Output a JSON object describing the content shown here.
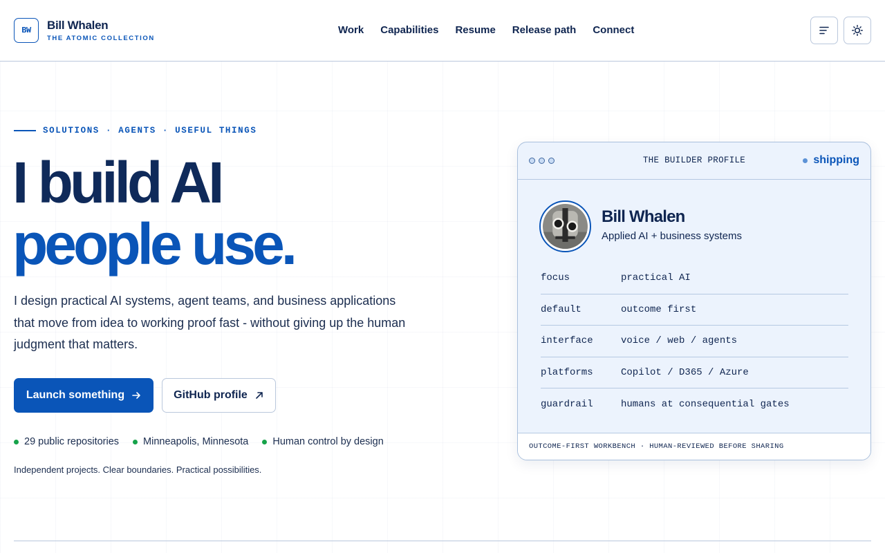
{
  "brand": {
    "initials": "BW",
    "name": "Bill Whalen",
    "tagline": "THE ATOMIC COLLECTION"
  },
  "nav": {
    "items": [
      {
        "label": "Work"
      },
      {
        "label": "Capabilities"
      },
      {
        "label": "Resume"
      },
      {
        "label": "Release path"
      },
      {
        "label": "Connect"
      }
    ]
  },
  "header_buttons": {
    "menu_icon": "menu-lines-icon",
    "theme_icon": "sun-icon"
  },
  "hero": {
    "eyebrow": "SOLUTIONS · AGENTS · USEFUL THINGS",
    "headline_line1": "I build AI",
    "headline_line2": "people use.",
    "lede": "I design practical AI systems, agent teams, and business applications that move from idea to working proof fast - without giving up the human judgment that matters.",
    "primary_cta": "Launch something",
    "primary_cta_icon": "arrow-right-icon",
    "secondary_cta": "GitHub profile",
    "secondary_cta_icon": "arrow-up-right-icon",
    "facts": [
      {
        "text": "29 public repositories"
      },
      {
        "text": "Minneapolis, Minnesota"
      },
      {
        "text": "Human control by design"
      }
    ],
    "tagline": "Independent projects. Clear boundaries. Practical possibilities."
  },
  "card": {
    "title": "THE BUILDER PROFILE",
    "status": "shipping",
    "name": "Bill Whalen",
    "role": "Applied AI + business systems",
    "specs": [
      {
        "key": "focus",
        "value": "practical AI"
      },
      {
        "key": "default",
        "value": "outcome first"
      },
      {
        "key": "interface",
        "value": "voice / web / agents"
      },
      {
        "key": "platforms",
        "value": "Copilot / D365 / Azure"
      },
      {
        "key": "guardrail",
        "value": "humans at consequential gates"
      }
    ],
    "footer": "OUTCOME-FIRST WORKBENCH · HUMAN-REVIEWED BEFORE SHARING"
  },
  "colors": {
    "accent": "#0a55b8",
    "ink": "#0f2550",
    "status_green": "#16a34a",
    "card_bg": "#ecf3fd"
  }
}
